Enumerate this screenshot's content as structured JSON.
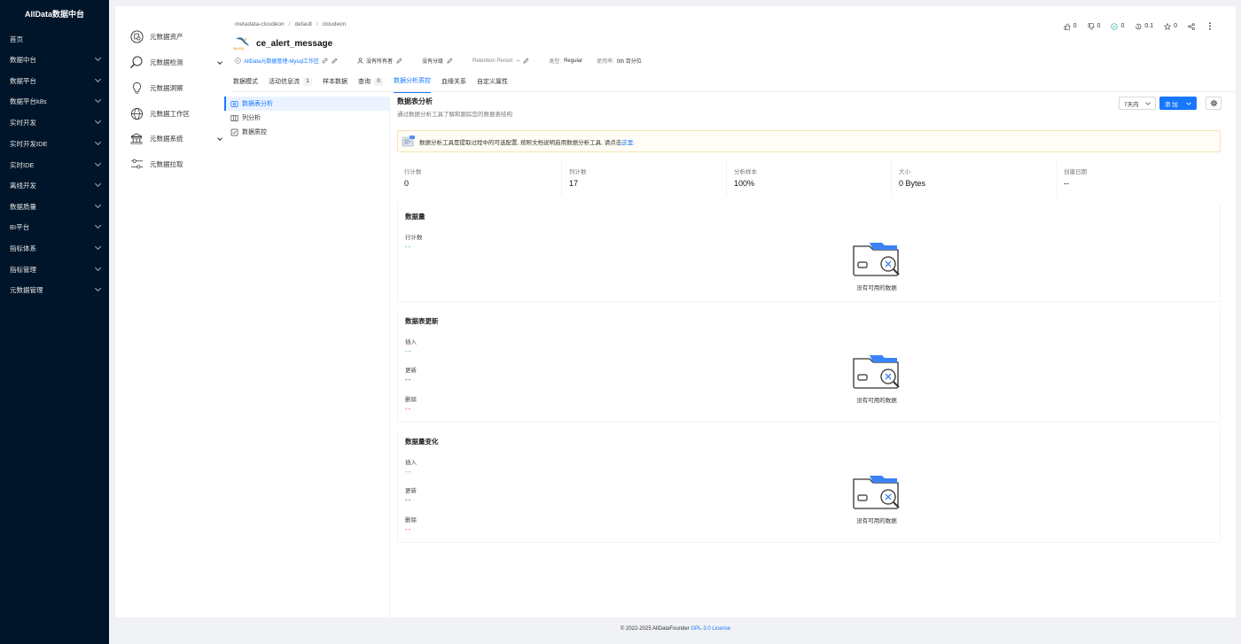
{
  "app": {
    "brand": "AllData数据中台"
  },
  "sidebar": {
    "items": [
      {
        "label": "首页",
        "chevron": false
      },
      {
        "label": "数据中台",
        "chevron": true
      },
      {
        "label": "数据平台",
        "chevron": true
      },
      {
        "label": "数据平台k8s",
        "chevron": true
      },
      {
        "label": "实时开发",
        "chevron": true
      },
      {
        "label": "实时开发IDE",
        "chevron": true
      },
      {
        "label": "实时IDE",
        "chevron": true
      },
      {
        "label": "离线开发",
        "chevron": true
      },
      {
        "label": "数据质量",
        "chevron": true
      },
      {
        "label": "BI平台",
        "chevron": true
      },
      {
        "label": "指标体系",
        "chevron": true
      },
      {
        "label": "指标管理",
        "chevron": true
      },
      {
        "label": "元数据管理",
        "chevron": true
      }
    ]
  },
  "subnav": {
    "items": [
      {
        "label": "元数据资产",
        "icon": "search-doc-icon"
      },
      {
        "label": "元数据检测",
        "icon": "magnifier-icon"
      },
      {
        "label": "元数据洞察",
        "icon": "lightbulb-icon"
      },
      {
        "label": "元数据工作区",
        "icon": "globe-icon"
      },
      {
        "label": "元数据系统",
        "icon": "bank-icon"
      },
      {
        "label": "元数据拉取",
        "icon": "sliders-icon"
      }
    ]
  },
  "header": {
    "breadcrumb": [
      "metadata-cloudeon",
      "default",
      "cloudeon"
    ],
    "title": "ce_alert_message",
    "platform_logo_text": "MySQL",
    "domain_link": "AllData元数据管理-Mysql工作区",
    "owner": "没有所有者",
    "tier": "没有分级",
    "retention_label": "Retention Period:",
    "retention_value": "--",
    "type_label": "类型:",
    "type_value": "Regular",
    "usage_label": "使用率:",
    "usage_value": "0th 百分位",
    "actions": {
      "likes": "0",
      "dislikes": "0",
      "alerts": "0",
      "version": "0.1",
      "stars": "0"
    }
  },
  "tabs": [
    {
      "label": "数据模式",
      "badge": ""
    },
    {
      "label": "活动信息流",
      "badge": "1"
    },
    {
      "label": "样本数据",
      "badge": ""
    },
    {
      "label": "查询",
      "badge": "0"
    },
    {
      "label": "数据分析质控",
      "badge": "",
      "active": true
    },
    {
      "label": "血缘关系",
      "badge": ""
    },
    {
      "label": "自定义属性",
      "badge": ""
    }
  ],
  "inner_nav": [
    {
      "label": "数据表分析",
      "active": true
    },
    {
      "label": "列分析",
      "active": false
    },
    {
      "label": "数据质控",
      "active": false
    }
  ],
  "content": {
    "title": "数据表分析",
    "subtitle": "通过数据分析工具了解和跟踪您的数据表结构",
    "range": "7天内",
    "add_label": "添 加",
    "alert_text": "数据分析工具是提取过程中的可选配置, 按照文档说明启用数据分析工具, 请点击",
    "alert_link": "这里.",
    "stats": [
      {
        "label": "行计数",
        "value": "0"
      },
      {
        "label": "列计数",
        "value": "17"
      },
      {
        "label": "分析样本",
        "value": "100%"
      },
      {
        "label": "大小",
        "value": "0 Bytes"
      },
      {
        "label": "创建日期",
        "value": "--"
      }
    ],
    "empty_text": "没有可用的数据",
    "cards": [
      {
        "title": "数据量",
        "metrics": [
          {
            "label": "行计数",
            "value": "--",
            "color": "#2fb3a8"
          }
        ]
      },
      {
        "title": "数据表更新",
        "metrics": [
          {
            "label": "插入",
            "value": "--",
            "color": "#2fb3a8"
          },
          {
            "label": "更新",
            "value": "--",
            "color": "#1f2f8a"
          },
          {
            "label": "删除",
            "value": "--",
            "color": "#e0442b"
          }
        ]
      },
      {
        "title": "数据量变化",
        "metrics": [
          {
            "label": "插入",
            "value": "--",
            "color": "#2fb3a8"
          },
          {
            "label": "更新",
            "value": "--",
            "color": "#1f2f8a"
          },
          {
            "label": "删除",
            "value": "--",
            "color": "#e0442b"
          }
        ]
      }
    ]
  },
  "footer": {
    "text": "© 2022-2025 AllDataFounder",
    "link": "GPL-3.0 License"
  },
  "colors": {
    "sidebar": "#001529",
    "accent": "#1677ff"
  }
}
